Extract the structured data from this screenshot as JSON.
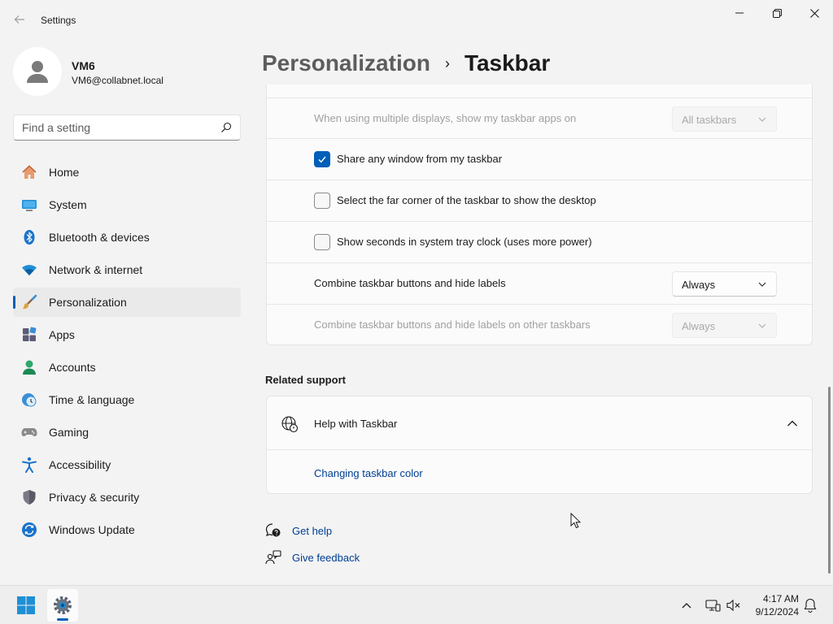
{
  "window": {
    "title": "Settings"
  },
  "profile": {
    "name": "VM6",
    "email": "VM6@collabnet.local"
  },
  "search": {
    "placeholder": "Find a setting"
  },
  "sidebar": {
    "items": [
      {
        "label": "Home",
        "icon": "home-icon",
        "active": false
      },
      {
        "label": "System",
        "icon": "display-icon",
        "active": false
      },
      {
        "label": "Bluetooth & devices",
        "icon": "bluetooth-icon",
        "active": false
      },
      {
        "label": "Network & internet",
        "icon": "wifi-icon",
        "active": false
      },
      {
        "label": "Personalization",
        "icon": "brush-icon",
        "active": true
      },
      {
        "label": "Apps",
        "icon": "apps-icon",
        "active": false
      },
      {
        "label": "Accounts",
        "icon": "person-icon",
        "active": false
      },
      {
        "label": "Time & language",
        "icon": "clock-globe-icon",
        "active": false
      },
      {
        "label": "Gaming",
        "icon": "gamepad-icon",
        "active": false
      },
      {
        "label": "Accessibility",
        "icon": "accessibility-icon",
        "active": false
      },
      {
        "label": "Privacy & security",
        "icon": "shield-icon",
        "active": false
      },
      {
        "label": "Windows Update",
        "icon": "update-icon",
        "active": false
      }
    ]
  },
  "header": {
    "parent": "Personalization",
    "separator": "›",
    "current": "Taskbar"
  },
  "settings": {
    "multi_display": {
      "label": "When using multiple displays, show my taskbar apps on",
      "value": "All taskbars",
      "disabled": true
    },
    "share_window": {
      "label": "Share any window from my taskbar",
      "checked": true
    },
    "far_corner": {
      "label": "Select the far corner of the taskbar to show the desktop",
      "checked": false
    },
    "show_seconds": {
      "label": "Show seconds in system tray clock (uses more power)",
      "checked": false
    },
    "combine_buttons": {
      "label": "Combine taskbar buttons and hide labels",
      "value": "Always",
      "disabled": false
    },
    "combine_other": {
      "label": "Combine taskbar buttons and hide labels on other taskbars",
      "value": "Always",
      "disabled": true
    }
  },
  "related_support": {
    "title": "Related support",
    "help_title": "Help with Taskbar",
    "link": "Changing taskbar color"
  },
  "help_links": {
    "get_help": "Get help",
    "give_feedback": "Give feedback"
  },
  "taskbar": {
    "time": "4:17 AM",
    "date": "9/12/2024"
  },
  "colors": {
    "accent": "#005fb8",
    "link": "#003e92",
    "background": "#f3f3f3",
    "card": "#fbfbfb"
  }
}
